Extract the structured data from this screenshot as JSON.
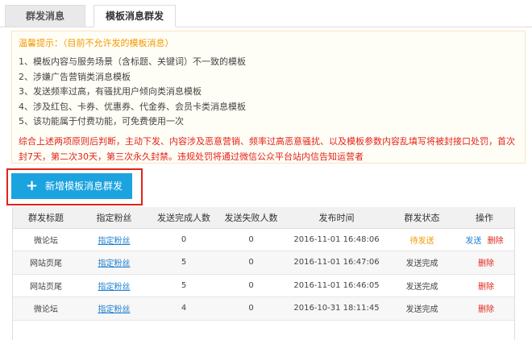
{
  "tabs": [
    {
      "label": "群发消息"
    },
    {
      "label": "模板消息群发"
    }
  ],
  "notice": {
    "title": "温馨提示：（目前不允许发的模板消息）",
    "items": [
      "1、模板内容与服务场景（含标题、关键词）不一致的模板",
      "2、涉嫌广告营销类消息模板",
      "3、发送频率过高，有骚扰用户倾向类消息模板",
      "4、涉及红包、卡券、优惠券、代金券、会员卡类消息模板",
      "5、该功能属于付费功能，可免费使用一次"
    ],
    "warning": "综合上述两项原则后判断，主动下发、内容涉及恶意营销、频率过高恶意骚扰、以及模板参数内容乱填写将被封接口处罚，首次封7天，第二次30天，第三次永久封禁。违规处罚将通过微信公众平台站内信告知运营者"
  },
  "add_button": {
    "icon": "plus-icon",
    "label": "新增模板消息群发"
  },
  "table": {
    "headers": [
      "群发标题",
      "指定粉丝",
      "发送完成人数",
      "发送失败人数",
      "发布时间",
      "群发状态",
      "操作"
    ],
    "rows": [
      {
        "title": "微论坛",
        "fans": "指定粉丝",
        "done": "0",
        "failed": "0",
        "time": "2016-11-01 16:48:06",
        "status": "待发送",
        "op_send": "发送",
        "op_delete": "删除"
      },
      {
        "title": "网站页尾",
        "fans": "指定粉丝",
        "done": "5",
        "failed": "0",
        "time": "2016-11-01 16:47:06",
        "status": "发送完成",
        "op_send": "",
        "op_delete": "删除"
      },
      {
        "title": "网站页尾",
        "fans": "指定粉丝",
        "done": "5",
        "failed": "0",
        "time": "2016-11-01 16:46:05",
        "status": "发送完成",
        "op_send": "",
        "op_delete": "删除"
      },
      {
        "title": "微论坛",
        "fans": "指定粉丝",
        "done": "4",
        "failed": "0",
        "time": "2016-10-31 18:11:45",
        "status": "发送完成",
        "op_send": "",
        "op_delete": "删除"
      }
    ]
  },
  "colors": {
    "accent": "#1ba3e0",
    "warning": "#e2231a",
    "tip": "#f39800",
    "link": "#1f7fd1"
  }
}
